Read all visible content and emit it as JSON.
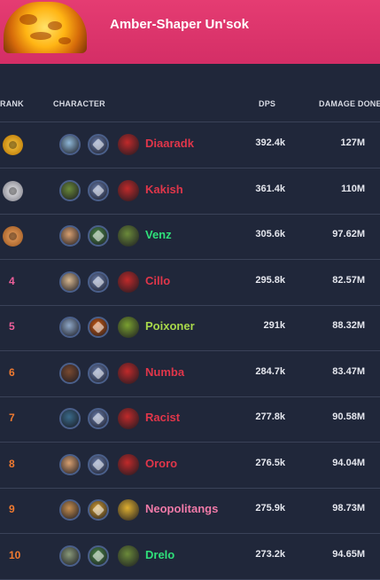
{
  "header": {
    "title": "Amber-Shaper Un'sok",
    "accent": "#e0366d"
  },
  "columns": {
    "rank": "RANK",
    "character": "CHARACTER",
    "dps": "DPS",
    "damage_done": "DAMAGE DONE"
  },
  "rows": [
    {
      "rank": "1",
      "name": "Diaaradk",
      "dps": "392.4k",
      "damage": "127M",
      "name_color": "#e0364a",
      "medal": "gold",
      "icons": [
        "human-face-icon",
        "frost-spec-icon",
        "death-knight-class-icon"
      ],
      "icon_colors": [
        "#8fb8d8",
        "#6a7fb0",
        "#c02a2a"
      ]
    },
    {
      "rank": "2",
      "name": "Kakish",
      "dps": "361.4k",
      "damage": "110M",
      "name_color": "#e0364a",
      "medal": "silver",
      "icons": [
        "orc-face-icon",
        "frost-spec-icon",
        "death-knight-class-icon"
      ],
      "icon_colors": [
        "#6a8a3a",
        "#6a7fb0",
        "#c02a2a"
      ]
    },
    {
      "rank": "3",
      "name": "Venz",
      "dps": "305.6k",
      "damage": "97.62M",
      "name_color": "#2fe07a",
      "medal": "bronze",
      "icons": [
        "human-face-icon",
        "windwalker-spec-icon",
        "monk-class-icon"
      ],
      "icon_colors": [
        "#d9a070",
        "#4b8a4a",
        "#6b8a3a"
      ]
    },
    {
      "rank": "4",
      "name": "Cillo",
      "dps": "295.8k",
      "damage": "82.57M",
      "name_color": "#e0364a",
      "medal": "",
      "rank_color": "#ee5f9a",
      "icons": [
        "human-face-icon",
        "frost-spec-icon",
        "death-knight-class-icon"
      ],
      "icon_colors": [
        "#d8b890",
        "#6a7fb0",
        "#c02a2a"
      ]
    },
    {
      "rank": "5",
      "name": "Poixoner",
      "dps": "291k",
      "damage": "88.32M",
      "name_color": "#a8d84a",
      "medal": "",
      "rank_color": "#ee5f9a",
      "icons": [
        "human-face-icon",
        "survival-spec-icon",
        "hunter-class-icon"
      ],
      "icon_colors": [
        "#8fa8c8",
        "#d05a10",
        "#7aa030"
      ]
    },
    {
      "rank": "6",
      "name": "Numba",
      "dps": "284.7k",
      "damage": "83.47M",
      "name_color": "#e0364a",
      "medal": "",
      "rank_color": "#f07a30",
      "icons": [
        "worgen-face-icon",
        "frost-spec-icon",
        "death-knight-class-icon"
      ],
      "icon_colors": [
        "#7a4a30",
        "#6a7fb0",
        "#c02a2a"
      ]
    },
    {
      "rank": "7",
      "name": "Racist",
      "dps": "277.8k",
      "damage": "90.58M",
      "name_color": "#e0364a",
      "medal": "",
      "rank_color": "#f07a30",
      "icons": [
        "draenei-face-icon",
        "frost-spec-icon",
        "death-knight-class-icon"
      ],
      "icon_colors": [
        "#3a6a8a",
        "#6a7fb0",
        "#c02a2a"
      ]
    },
    {
      "rank": "8",
      "name": "Ororo",
      "dps": "276.5k",
      "damage": "94.04M",
      "name_color": "#e0364a",
      "medal": "",
      "rank_color": "#f07a30",
      "icons": [
        "human-face-icon",
        "frost-spec-icon",
        "death-knight-class-icon"
      ],
      "icon_colors": [
        "#d9a070",
        "#6a7fb0",
        "#c02a2a"
      ]
    },
    {
      "rank": "9",
      "name": "Neopolitangs",
      "dps": "275.9k",
      "damage": "98.73M",
      "name_color": "#f07aa8",
      "medal": "",
      "rank_color": "#f07a30",
      "icons": [
        "human-face-icon",
        "retribution-spec-icon",
        "paladin-class-icon"
      ],
      "icon_colors": [
        "#c89050",
        "#d9a030",
        "#e0b030"
      ]
    },
    {
      "rank": "10",
      "name": "Drelo",
      "dps": "273.2k",
      "damage": "94.65M",
      "name_color": "#2fe07a",
      "medal": "",
      "rank_color": "#f07a30",
      "icons": [
        "orc-face-icon",
        "windwalker-spec-icon",
        "monk-class-icon"
      ],
      "icon_colors": [
        "#8a9a7a",
        "#4b8a4a",
        "#6b8a3a"
      ]
    }
  ]
}
